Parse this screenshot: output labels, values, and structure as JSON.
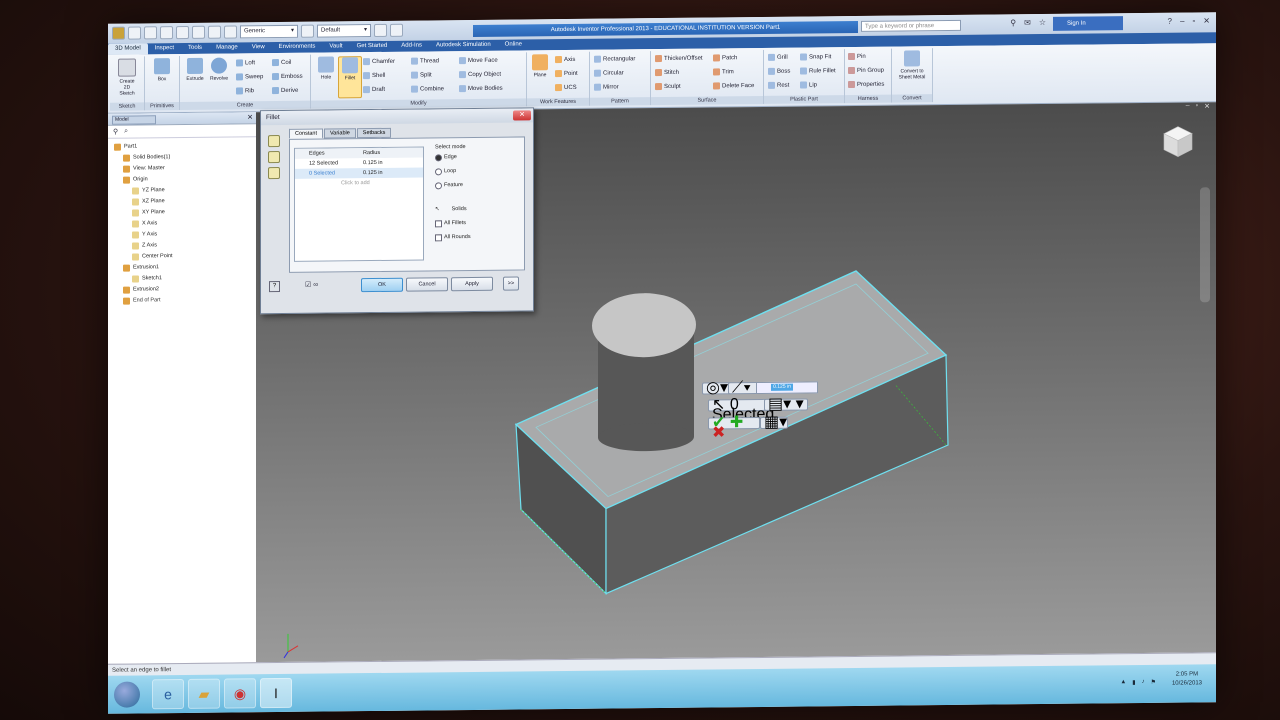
{
  "app": {
    "title": "Autodesk Inventor Professional 2013 - EDUCATIONAL INSTITUTION VERSION    Part1",
    "material_combo": "Generic",
    "appearance_combo": "Default",
    "search_placeholder": "Type a keyword or phrase",
    "signin": "Sign In"
  },
  "tabs": [
    "3D Model",
    "Inspect",
    "Tools",
    "Manage",
    "View",
    "Environments",
    "Vault",
    "Get Started",
    "Add-Ins",
    "Autodesk Simulation",
    "Online"
  ],
  "ribbon": {
    "groups": {
      "sketch": "Sketch",
      "primitives": "Primitives",
      "create": "Create",
      "modify": "Modify",
      "work_features": "Work Features",
      "pattern": "Pattern",
      "surface": "Surface",
      "plastic_part": "Plastic Part",
      "harness": "Harness",
      "convert": "Convert"
    },
    "buttons": {
      "create_sketch": "Create 2D Sketch",
      "box": "Box",
      "extrude": "Extrude",
      "revolve": "Revolve",
      "loft": "Loft",
      "sweep": "Sweep",
      "rib": "Rib",
      "coil": "Coil",
      "emboss": "Emboss",
      "derive": "Derive",
      "hole": "Hole",
      "fillet": "Fillet",
      "chamfer": "Chamfer",
      "shell": "Shell",
      "draft": "Draft",
      "thread": "Thread",
      "split": "Split",
      "combine": "Combine",
      "move_face": "Move Face",
      "copy_object": "Copy Object",
      "move_bodies": "Move Bodies",
      "plane": "Plane",
      "axis": "Axis",
      "point": "Point",
      "ucs": "UCS",
      "rectangular": "Rectangular",
      "circular": "Circular",
      "mirror": "Mirror",
      "thicken_offset": "Thicken/Offset",
      "stitch": "Stitch",
      "sculpt": "Sculpt",
      "patch": "Patch",
      "trim": "Trim",
      "delete_face": "Delete Face",
      "grill": "Grill",
      "boss": "Boss",
      "rest": "Rest",
      "snap_fit": "Snap Fit",
      "rule_fillet": "Rule Fillet",
      "lip": "Lip",
      "pin": "Pin",
      "pin_group": "Pin Group",
      "properties": "Properties",
      "convert_sheet_metal": "Convert to Sheet Metal"
    }
  },
  "browser": {
    "title": "Model",
    "tree": [
      {
        "label": "Part1",
        "indent": 0
      },
      {
        "label": "Solid Bodies(1)",
        "indent": 1
      },
      {
        "label": "View: Master",
        "indent": 1
      },
      {
        "label": "Origin",
        "indent": 1
      },
      {
        "label": "YZ Plane",
        "indent": 2
      },
      {
        "label": "XZ Plane",
        "indent": 2
      },
      {
        "label": "XY Plane",
        "indent": 2
      },
      {
        "label": "X Axis",
        "indent": 2
      },
      {
        "label": "Y Axis",
        "indent": 2
      },
      {
        "label": "Z Axis",
        "indent": 2
      },
      {
        "label": "Center Point",
        "indent": 2
      },
      {
        "label": "Extrusion1",
        "indent": 1
      },
      {
        "label": "Sketch1",
        "indent": 2
      },
      {
        "label": "Extrusion2",
        "indent": 1
      },
      {
        "label": "End of Part",
        "indent": 1
      }
    ]
  },
  "fillet_dialog": {
    "title": "Fillet",
    "tabs": [
      "Constant",
      "Variable",
      "Setbacks"
    ],
    "columns": [
      "Edges",
      "Radius"
    ],
    "rows": [
      {
        "edges": "12 Selected",
        "radius": "0.125 in"
      },
      {
        "edges": "0 Selected",
        "radius": "0.125 in"
      }
    ],
    "click_to_add": "Click to add",
    "select_mode_label": "Select mode",
    "modes": [
      "Edge",
      "Loop",
      "Feature"
    ],
    "solids_label": "Solids",
    "all_fillets": "All Fillets",
    "all_rounds": "All Rounds",
    "ok": "OK",
    "cancel": "Cancel",
    "apply": "Apply",
    "more": ">>"
  },
  "minitoolbar": {
    "selected": "0 Selected",
    "radius_value": "0.125 in"
  },
  "status": "Select an edge to fillet",
  "clock": {
    "time": "2:05 PM",
    "date": "10/26/2013"
  },
  "colors": {
    "accent": "#2c5fa8",
    "highlight_edge": "#6fe0f0",
    "viewport_top": "#4c4c4c",
    "viewport_bottom": "#9a9a9a"
  }
}
